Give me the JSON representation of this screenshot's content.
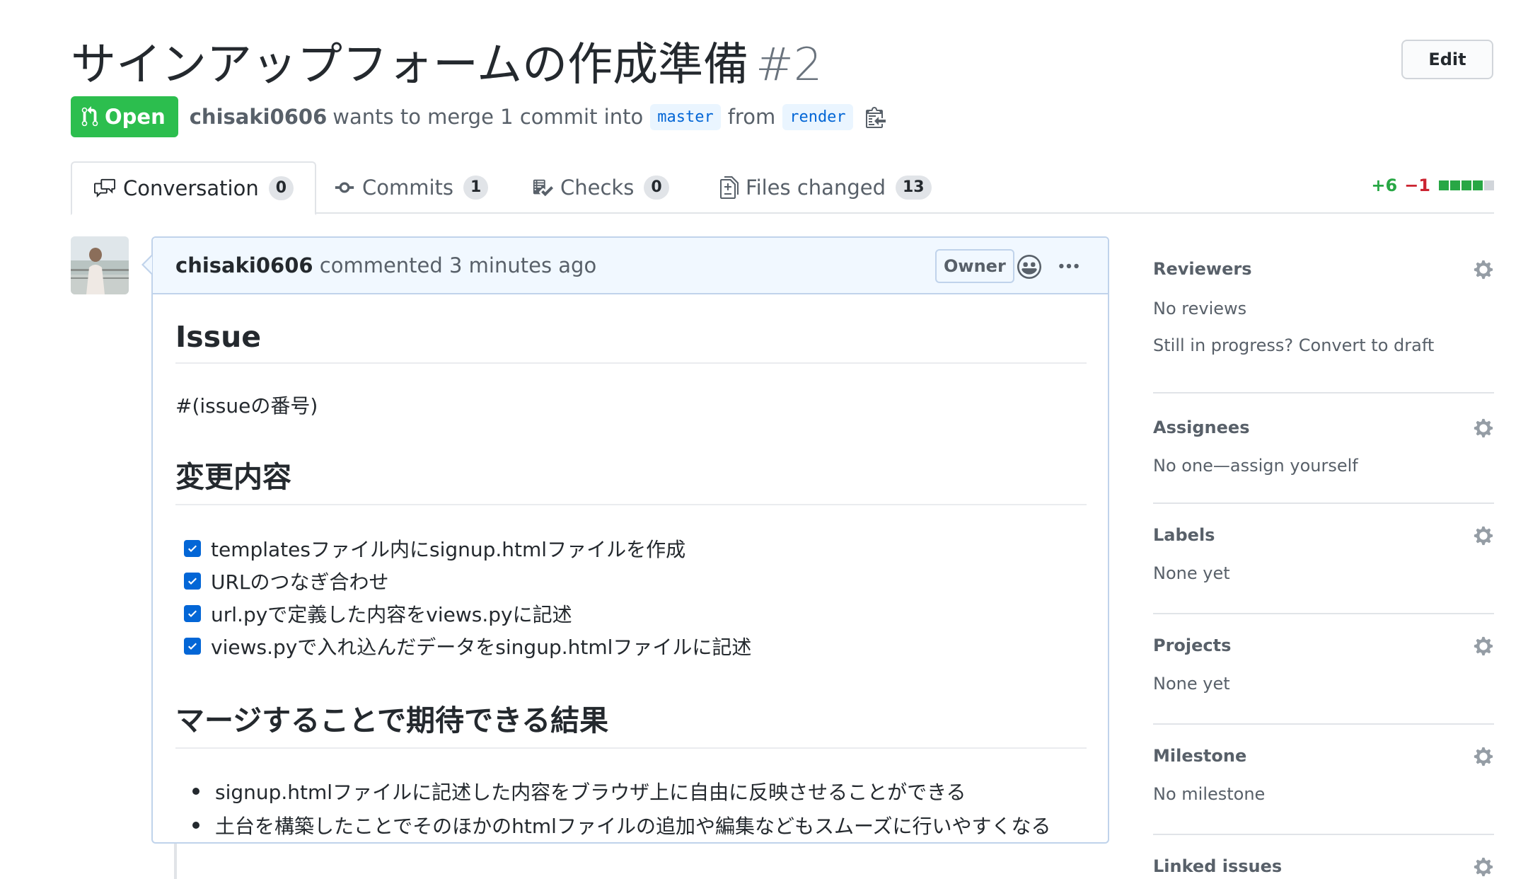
{
  "pr": {
    "title": "サインアップフォームの作成準備",
    "number": "#2",
    "edit_label": "Edit",
    "state": "Open",
    "author": "chisaki0606",
    "merge_text": "wants to merge 1 commit into",
    "base_branch": "master",
    "from_text": "from",
    "head_branch": "render"
  },
  "tabs": [
    {
      "label": "Conversation",
      "count": "0",
      "icon": "comment-discussion-icon"
    },
    {
      "label": "Commits",
      "count": "1",
      "icon": "git-commit-icon"
    },
    {
      "label": "Checks",
      "count": "0",
      "icon": "checklist-icon"
    },
    {
      "label": "Files changed",
      "count": "13",
      "icon": "file-diff-icon"
    }
  ],
  "diffstat": {
    "additions": "+6",
    "deletions": "−1",
    "colors": [
      "#28a745",
      "#28a745",
      "#28a745",
      "#28a745",
      "#d1d5da"
    ]
  },
  "comment": {
    "author": "chisaki0606",
    "action": "commented 3 minutes ago",
    "badge": "Owner",
    "h_issue": "Issue",
    "issue_ref": "#(issueの番号)",
    "h_changes": "変更内容",
    "tasks": [
      "templatesファイル内にsignup.htmlファイルを作成",
      "URLのつなぎ合わせ",
      "url.pyで定義した内容をviews.pyに記述",
      "views.pyで入れ込んだデータをsingup.htmlファイルに記述"
    ],
    "h_results": "マージすることで期待できる結果",
    "results": [
      "signup.htmlファイルに記述した内容をブラウザ上に自由に反映させることができる",
      "土台を構築したことでそのほかのhtmlファイルの追加や編集などもスムーズに行いやすくなる"
    ]
  },
  "sidebar": {
    "reviewers": {
      "heading": "Reviewers",
      "value": "No reviews",
      "extra": "Still in progress? Convert to draft"
    },
    "assignees": {
      "heading": "Assignees",
      "value": "No one—assign yourself"
    },
    "labels": {
      "heading": "Labels",
      "value": "None yet"
    },
    "projects": {
      "heading": "Projects",
      "value": "None yet"
    },
    "milestone": {
      "heading": "Milestone",
      "value": "No milestone"
    },
    "linked": {
      "heading": "Linked issues"
    }
  },
  "colors": {
    "accent": "#0366d6",
    "open": "#2cbe4e"
  }
}
